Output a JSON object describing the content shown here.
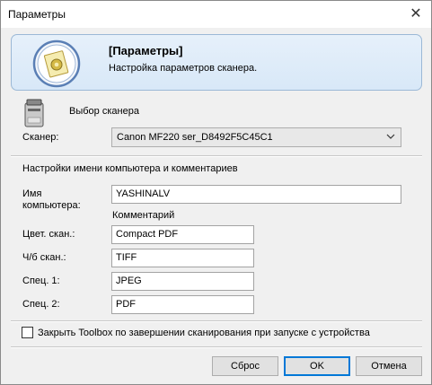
{
  "window": {
    "title": "Параметры"
  },
  "header": {
    "title": "[Параметры]",
    "subtitle": "Настройка параметров сканера."
  },
  "scanner_section": {
    "heading": "Выбор сканера",
    "scanner_label": "Сканер:",
    "scanner_value": "Canon MF220 ser_D8492F5C45C1"
  },
  "names_section": {
    "heading": "Настройки имени компьютера и комментариев",
    "computer_name_label_1": "Имя",
    "computer_name_label_2": "компьютера:",
    "computer_name_value": "YASHINALV",
    "comment_heading": "Комментарий",
    "rows": [
      {
        "label": "Цвет. скан.:",
        "value": "Compact PDF"
      },
      {
        "label": "Ч/б скан.:",
        "value": "TIFF"
      },
      {
        "label": "Спец. 1:",
        "value": "JPEG"
      },
      {
        "label": "Спец. 2:",
        "value": "PDF"
      }
    ]
  },
  "close_toolbox_checkbox": {
    "label": "Закрыть Toolbox по завершении сканирования при запуске с устройства",
    "checked": false
  },
  "buttons": {
    "reset": "Сброс",
    "ok": "OK",
    "cancel": "Отмена"
  },
  "icons": [
    "close-icon",
    "settings-document-icon",
    "scanner-icon",
    "chevron-down-icon"
  ],
  "colors": {
    "header_bg": "#dbe9f8",
    "accent": "#0078d7"
  }
}
